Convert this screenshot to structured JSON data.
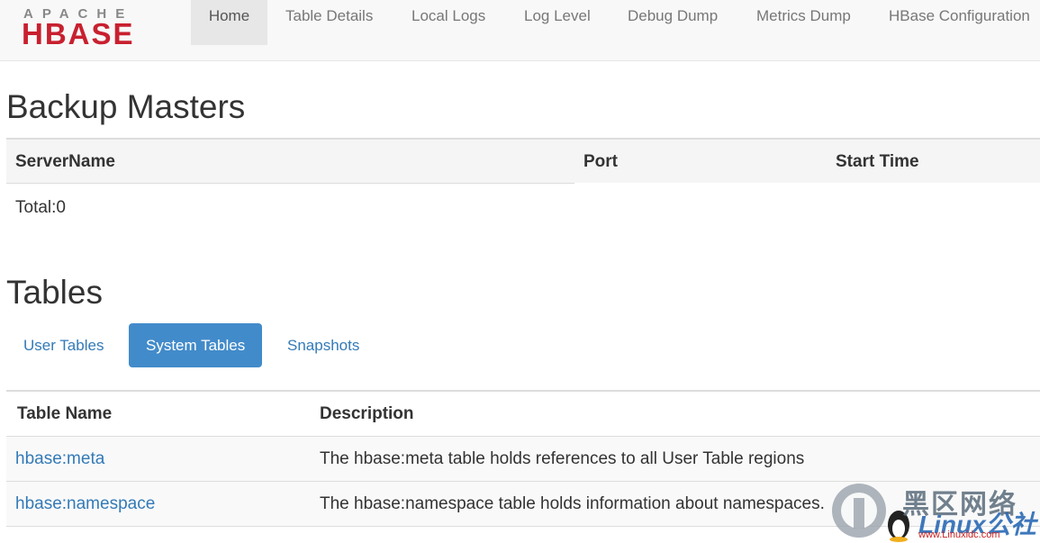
{
  "logo": {
    "top": "APACHE",
    "main": "HBASE"
  },
  "nav": {
    "items": [
      {
        "label": "Home",
        "active": true
      },
      {
        "label": "Table Details"
      },
      {
        "label": "Local Logs"
      },
      {
        "label": "Log Level"
      },
      {
        "label": "Debug Dump"
      },
      {
        "label": "Metrics Dump"
      },
      {
        "label": "HBase Configuration"
      }
    ]
  },
  "backup_masters": {
    "title": "Backup Masters",
    "columns": [
      "ServerName",
      "Port",
      "Start Time"
    ],
    "total": "Total:0"
  },
  "tables": {
    "title": "Tables",
    "tabs": [
      {
        "label": "User Tables"
      },
      {
        "label": "System Tables",
        "active": true
      },
      {
        "label": "Snapshots"
      }
    ],
    "columns": [
      "Table Name",
      "Description"
    ],
    "rows": [
      {
        "name": "hbase:meta",
        "description": "The hbase:meta table holds references to all User Table regions"
      },
      {
        "name": "hbase:namespace",
        "description": "The hbase:namespace table holds information about namespaces."
      }
    ]
  },
  "watermark": {
    "line1": "黑区网络",
    "line2": "Linux公社",
    "line3": "www.Linuxidc.com"
  },
  "colors": {
    "link": "#337ab7",
    "active_tab": "#428bca",
    "logo_red": "#c8202f",
    "navbar_bg": "#f8f8f8"
  }
}
